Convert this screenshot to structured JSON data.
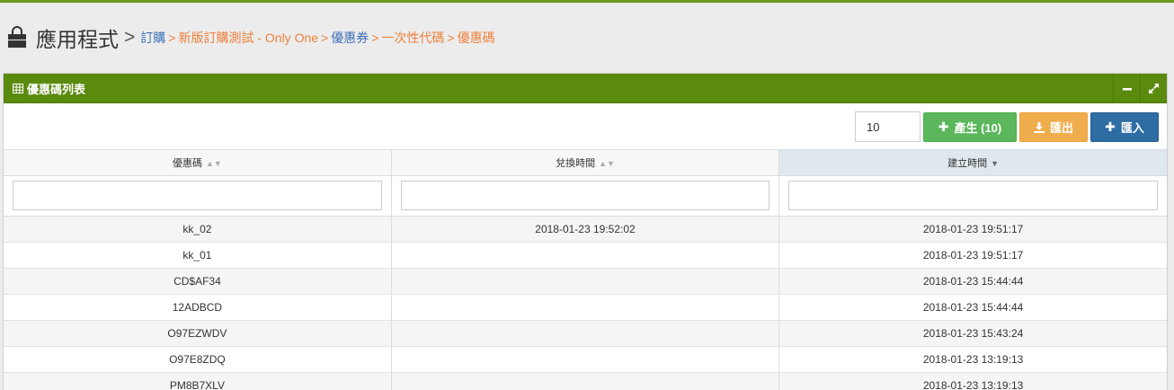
{
  "header": {
    "title": "應用程式",
    "separator": ">",
    "breadcrumbs": [
      {
        "label": "訂購",
        "color": "#3b6fb6"
      },
      {
        "label": "新版訂購測試 - Only One",
        "color": "#f0803c"
      },
      {
        "label": "優惠券",
        "color": "#3b6fb6"
      },
      {
        "label": "一次性代碼",
        "color": "#f0803c"
      },
      {
        "label": "優惠碼",
        "color": "#f0803c"
      }
    ]
  },
  "widget": {
    "title": "優惠碼列表",
    "header_color": "#5a8a0e"
  },
  "toolbar": {
    "count_value": "10",
    "generate_label": "產生 (10)",
    "export_label": "匯出",
    "import_label": "匯入"
  },
  "table": {
    "columns": [
      "優惠碼",
      "兌換時間",
      "建立時間"
    ],
    "rows": [
      [
        "kk_02",
        "2018-01-23 19:52:02",
        "2018-01-23 19:51:17"
      ],
      [
        "kk_01",
        "",
        "2018-01-23 19:51:17"
      ],
      [
        "CD$AF34",
        "",
        "2018-01-23 15:44:44"
      ],
      [
        "12ADBCD",
        "",
        "2018-01-23 15:44:44"
      ],
      [
        "O97EZWDV",
        "",
        "2018-01-23 15:43:24"
      ],
      [
        "O97E8ZDQ",
        "",
        "2018-01-23 13:19:13"
      ],
      [
        "PM8B7XLV",
        "",
        "2018-01-23 13:19:13"
      ]
    ]
  }
}
